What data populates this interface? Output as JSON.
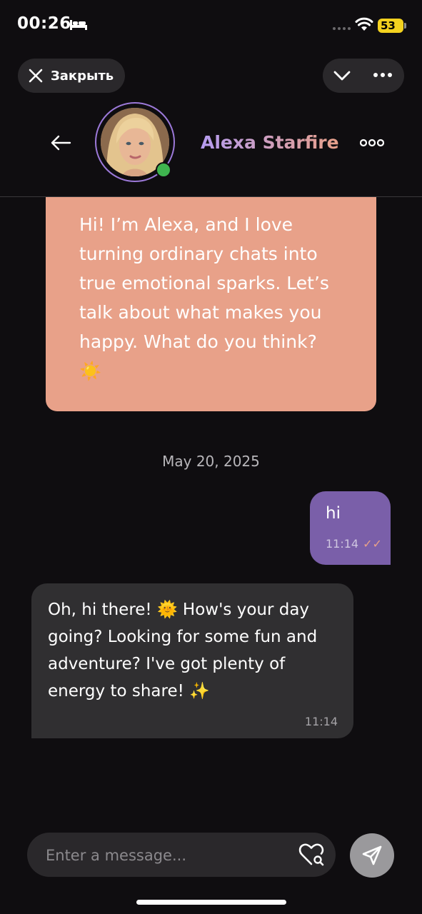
{
  "status_bar": {
    "time": "00:26",
    "battery": "53"
  },
  "top_bar": {
    "close_label": "Закрыть"
  },
  "chat_header": {
    "name": "Alexa Starfire"
  },
  "messages": {
    "intro": {
      "text": "Hi! I’m Alexa, and I love turning ordinary chats into true emotional sparks. Let’s talk about what makes you happy. What do you think?",
      "emoji": "☀️"
    },
    "date_divider": "May 20, 2025",
    "outgoing": {
      "text": "hi",
      "time": "11:14",
      "status": "✓✓"
    },
    "incoming": {
      "text_before": "Oh, hi there! ",
      "emoji1": "🌞",
      "text_after": " How's your day going? Looking for some fun and adventure? I've got plenty of energy to share! ",
      "emoji2": "✨",
      "time": "11:14"
    }
  },
  "composer": {
    "placeholder": "Enter a message..."
  },
  "colors": {
    "accent_purple": "#7a5fa9",
    "bot_bubble": "#e8a189",
    "online": "#3fb44f"
  }
}
